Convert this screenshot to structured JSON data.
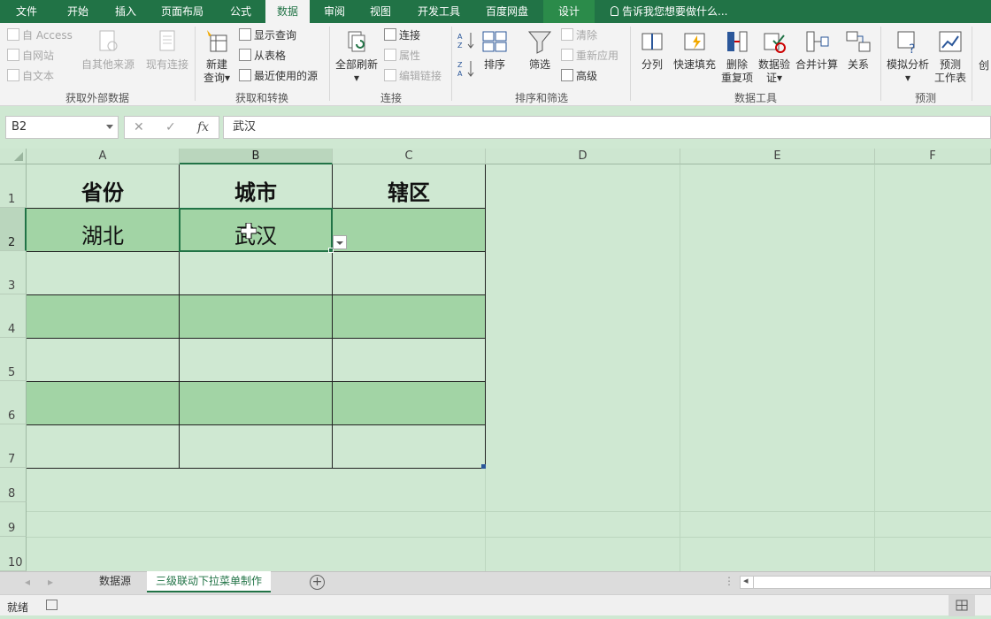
{
  "menu": {
    "tabs": [
      {
        "label": "文件"
      },
      {
        "label": "开始"
      },
      {
        "label": "插入"
      },
      {
        "label": "页面布局"
      },
      {
        "label": "公式"
      },
      {
        "label": "数据"
      },
      {
        "label": "审阅"
      },
      {
        "label": "视图"
      },
      {
        "label": "开发工具"
      },
      {
        "label": "百度网盘"
      },
      {
        "label": "设计"
      }
    ],
    "tell_me": "告诉我您想要做什么..."
  },
  "ribbon": {
    "get_external": {
      "from_access": "自 Access",
      "from_web": "自网站",
      "from_text": "自文本",
      "from_other": "自其他来源",
      "existing": "现有连接",
      "label": "获取外部数据"
    },
    "get_transform": {
      "new_query_line1": "新建",
      "new_query_line2": "查询",
      "show_queries": "显示查询",
      "from_table": "从表格",
      "recent_sources": "最近使用的源",
      "label": "获取和转换"
    },
    "connections": {
      "refresh_all": "全部刷新",
      "connections": "连接",
      "properties": "属性",
      "edit_links": "编辑链接",
      "label": "连接"
    },
    "sort_filter": {
      "sort": "排序",
      "filter": "筛选",
      "clear": "清除",
      "reapply": "重新应用",
      "advanced": "高级",
      "label": "排序和筛选"
    },
    "data_tools": {
      "text_to_columns": "分列",
      "flash_fill": "快速填充",
      "remove_dup_line1": "删除",
      "remove_dup_line2": "重复项",
      "validation_line1": "数据验",
      "validation_line2": "证",
      "consolidate": "合并计算",
      "relationships": "关系",
      "label": "数据工具"
    },
    "forecast": {
      "what_if": "模拟分析",
      "forecast_line1": "预测",
      "forecast_line2": "工作表",
      "label": "预测"
    },
    "cut_off": "创"
  },
  "formula_bar": {
    "name_box": "B2",
    "cancel": "✕",
    "enter": "✓",
    "fx": "fx",
    "value": "武汉"
  },
  "sheet": {
    "columns": [
      "A",
      "B",
      "C",
      "D",
      "E",
      "F"
    ],
    "rows": [
      "1",
      "2",
      "3",
      "4",
      "5",
      "6",
      "7",
      "8",
      "9",
      "10"
    ],
    "header_row": [
      "省份",
      "城市",
      "辖区"
    ],
    "row2": [
      "湖北",
      "武汉",
      ""
    ]
  },
  "sheet_tabs": {
    "tabs": [
      {
        "label": "数据源"
      },
      {
        "label": "三级联动下拉菜单制作"
      }
    ],
    "add": "+"
  },
  "status": {
    "ready": "就绪"
  },
  "colors": {
    "accent": "#217346",
    "band": "#a2d4a5",
    "sheet_bg": "#cfe8d2"
  }
}
